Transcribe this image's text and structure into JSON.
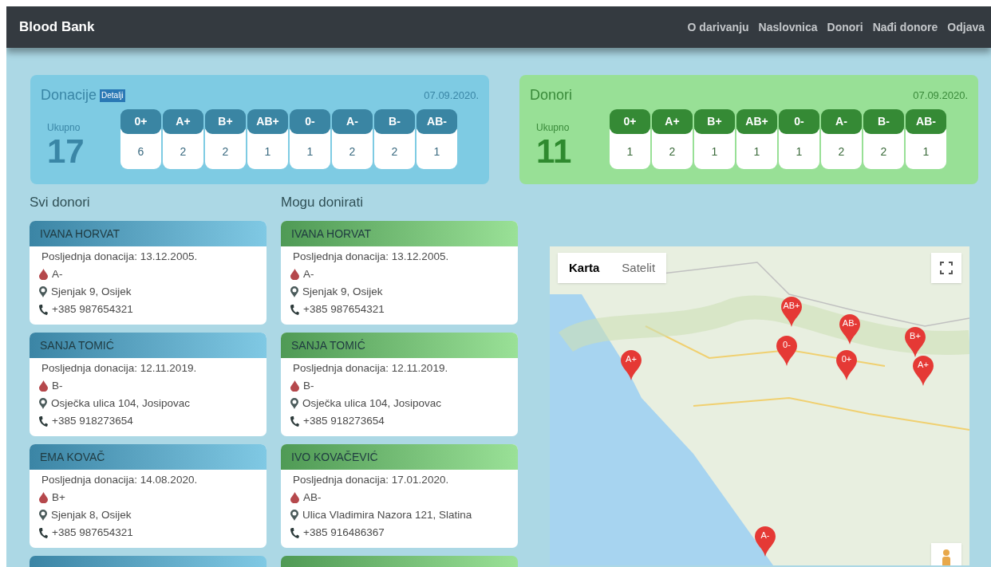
{
  "navbar": {
    "brand": "Blood Bank",
    "links": [
      "O darivanju",
      "Naslovnica",
      "Donori",
      "Nađi donore",
      "Odjava"
    ]
  },
  "summaries": [
    {
      "kind": "blue",
      "title": "Donacije",
      "details_button": "Detalji",
      "date": "07.09.2020.",
      "total_label": "Ukupno",
      "total": "17",
      "groups": [
        {
          "type": "0+",
          "count": "6"
        },
        {
          "type": "A+",
          "count": "2"
        },
        {
          "type": "B+",
          "count": "2"
        },
        {
          "type": "AB+",
          "count": "1"
        },
        {
          "type": "0-",
          "count": "1"
        },
        {
          "type": "A-",
          "count": "2"
        },
        {
          "type": "B-",
          "count": "2"
        },
        {
          "type": "AB-",
          "count": "1"
        }
      ]
    },
    {
      "kind": "green",
      "title": "Donori",
      "date": "07.09.2020.",
      "total_label": "Ukupno",
      "total": "11",
      "groups": [
        {
          "type": "0+",
          "count": "1"
        },
        {
          "type": "A+",
          "count": "2"
        },
        {
          "type": "B+",
          "count": "1"
        },
        {
          "type": "AB+",
          "count": "1"
        },
        {
          "type": "0-",
          "count": "1"
        },
        {
          "type": "A-",
          "count": "2"
        },
        {
          "type": "B-",
          "count": "2"
        },
        {
          "type": "AB-",
          "count": "1"
        }
      ]
    }
  ],
  "lists": [
    {
      "kind": "blue",
      "title": "Svi donori",
      "donors": [
        {
          "name": "IVANA HORVAT",
          "last_donation": "Posljednja donacija: 13.12.2005.",
          "blood_type": "A-",
          "address": "Sjenjak 9, Osijek",
          "phone": "+385 987654321"
        },
        {
          "name": "SANJA TOMIĆ",
          "last_donation": "Posljednja donacija: 12.11.2019.",
          "blood_type": "B-",
          "address": "Osječka ulica 104, Josipovac",
          "phone": "+385 918273654"
        },
        {
          "name": "EMA KOVAČ",
          "last_donation": "Posljednja donacija: 14.08.2020.",
          "blood_type": "B+",
          "address": "Sjenjak 8, Osijek",
          "phone": "+385 987654321"
        }
      ]
    },
    {
      "kind": "green",
      "title": "Mogu donirati",
      "donors": [
        {
          "name": "IVANA HORVAT",
          "last_donation": "Posljednja donacija: 13.12.2005.",
          "blood_type": "A-",
          "address": "Sjenjak 9, Osijek",
          "phone": "+385 987654321"
        },
        {
          "name": "SANJA TOMIĆ",
          "last_donation": "Posljednja donacija: 12.11.2019.",
          "blood_type": "B-",
          "address": "Osječka ulica 104, Josipovac",
          "phone": "+385 918273654"
        },
        {
          "name": "IVO KOVAČEVIĆ",
          "last_donation": "Posljednja donacija: 17.01.2020.",
          "blood_type": "AB-",
          "address": "Ulica Vladimira Nazora 121, Slatina",
          "phone": "+385 916486367"
        }
      ]
    }
  ],
  "map": {
    "map_types": [
      {
        "label": "Karta",
        "selected": true
      },
      {
        "label": "Satelit",
        "selected": false
      }
    ],
    "markers": [
      "A+",
      "AB+",
      "0-",
      "AB-",
      "0+",
      "B+",
      "A+",
      "A-"
    ]
  }
}
